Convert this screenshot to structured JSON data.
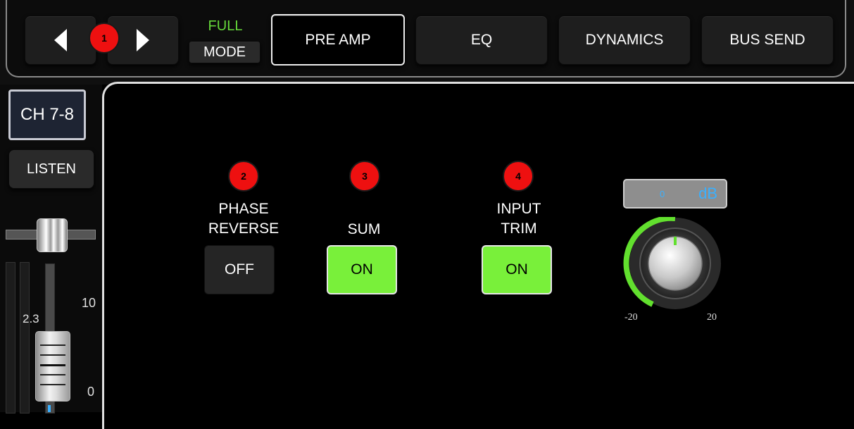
{
  "header": {
    "mode_status": "FULL",
    "mode_button": "MODE",
    "tabs": [
      {
        "label": "PRE AMP",
        "active": true
      },
      {
        "label": "EQ",
        "active": false
      },
      {
        "label": "DYNAMICS",
        "active": false
      },
      {
        "label": "BUS SEND",
        "active": false
      }
    ]
  },
  "sidebar": {
    "channel": "CH 7-8",
    "listen": "LISTEN",
    "fader_value": "2.3",
    "scale_top": "10",
    "scale_bottom": "0"
  },
  "annotations": [
    "1",
    "2",
    "3",
    "4"
  ],
  "preamp": {
    "phase_reverse": {
      "label_line1": "PHASE",
      "label_line2": "REVERSE",
      "state": "OFF"
    },
    "sum": {
      "label": "SUM",
      "state": "ON"
    },
    "input_trim": {
      "label_line1": "INPUT",
      "label_line2": "TRIM",
      "state": "ON"
    },
    "gain": {
      "value": "0",
      "unit": "dB",
      "min_label": "-20",
      "max_label": "20"
    }
  },
  "colors": {
    "on_green": "#79f03a",
    "full_green": "#66d83a",
    "badge_red": "#ee1010",
    "db_blue": "#3ab0ff"
  }
}
